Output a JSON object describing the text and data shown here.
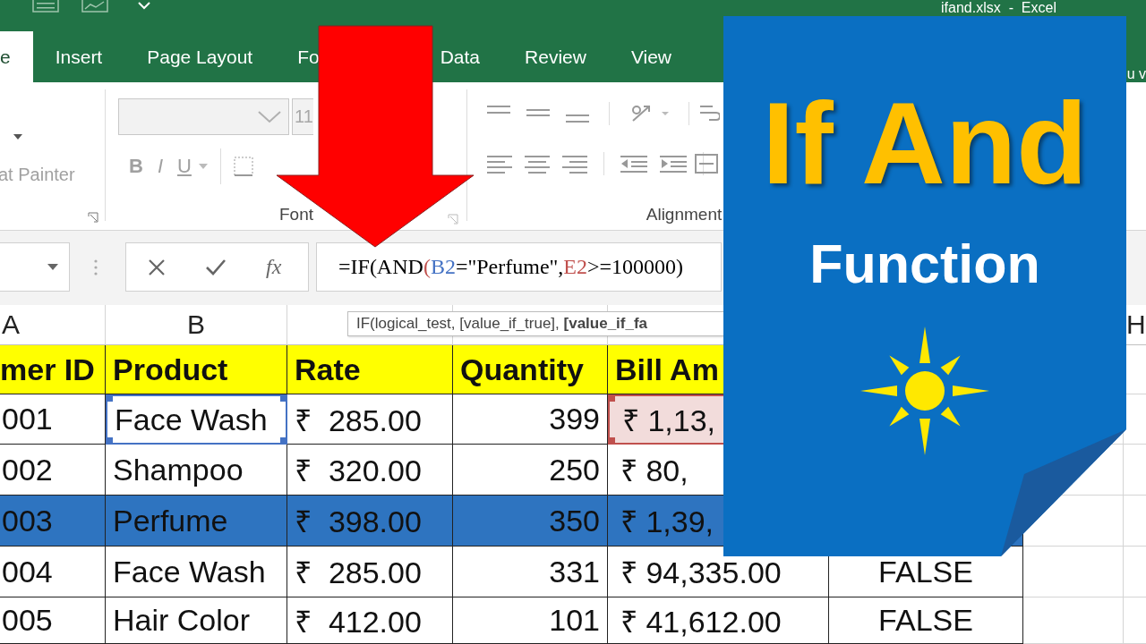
{
  "window": {
    "title": "ifand.xlsx  -  Excel"
  },
  "tabs": [
    {
      "label": "e",
      "selected": true
    },
    {
      "label": "Insert",
      "selected": false
    },
    {
      "label": "Page Layout",
      "selected": false
    },
    {
      "label": "Fo",
      "selected": false
    },
    {
      "label": "Data",
      "selected": false
    },
    {
      "label": "Review",
      "selected": false
    },
    {
      "label": "View",
      "selected": false
    }
  ],
  "tell_me": "u v",
  "ribbon": {
    "clipboard": {
      "format_painter": "at Painter"
    },
    "font": {
      "label": "Font",
      "size": "11",
      "buttons": [
        "B",
        "I",
        "U"
      ]
    },
    "alignment": {
      "label": "Alignment"
    }
  },
  "formula_bar": {
    "insert_function": "fx",
    "formula": [
      {
        "text": "=IF(AND",
        "color": "#000000"
      },
      {
        "text": "(",
        "color": "#c0504d"
      },
      {
        "text": "B2",
        "color": "#4472c4"
      },
      {
        "text": "=\"Perfume\",",
        "color": "#000000"
      },
      {
        "text": "E2",
        "color": "#c0504d"
      },
      {
        "text": ">=100000)",
        "color": "#000000"
      }
    ]
  },
  "tooltip": "IF(logical_test, [value_if_true], **[value_if_fa**",
  "column_headers": [
    "A",
    "B"
  ],
  "last_column_header": "H",
  "table": {
    "columns": [
      "mer ID",
      "Product",
      "Rate",
      "Quantity",
      "Bill Am"
    ],
    "rows": [
      {
        "selected": false,
        "cells": [
          {
            "text": "001"
          },
          {
            "text": "Face Wash",
            "color": "#4472c4"
          },
          {
            "text": "₹  285.00"
          },
          {
            "text": "399"
          },
          {
            "text": "₹ 1,13,",
            "color": "#c0504d"
          }
        ]
      },
      {
        "selected": false,
        "cells": [
          {
            "text": "002"
          },
          {
            "text": "Shampoo"
          },
          {
            "text": "₹  320.00"
          },
          {
            "text": "250"
          },
          {
            "text": "₹ 80,"
          }
        ]
      },
      {
        "selected": true,
        "cells": [
          {
            "text": "003"
          },
          {
            "text": "Perfume"
          },
          {
            "text": "₹  398.00"
          },
          {
            "text": "350"
          },
          {
            "text": "₹ 1,39,"
          }
        ]
      },
      {
        "selected": false,
        "cells": [
          {
            "text": "004"
          },
          {
            "text": "Face Wash"
          },
          {
            "text": "₹  285.00"
          },
          {
            "text": "331"
          },
          {
            "text": "₹ 94,335.00"
          },
          {
            "text": "FALSE"
          }
        ]
      },
      {
        "selected": false,
        "cells": [
          {
            "text": "005"
          },
          {
            "text": "Hair Color"
          },
          {
            "text": "₹  412.00"
          },
          {
            "text": "101"
          },
          {
            "text": "₹ 41,612.00"
          },
          {
            "text": "FALSE"
          }
        ]
      }
    ]
  },
  "card": {
    "title": "If And",
    "subtitle": "Function"
  }
}
